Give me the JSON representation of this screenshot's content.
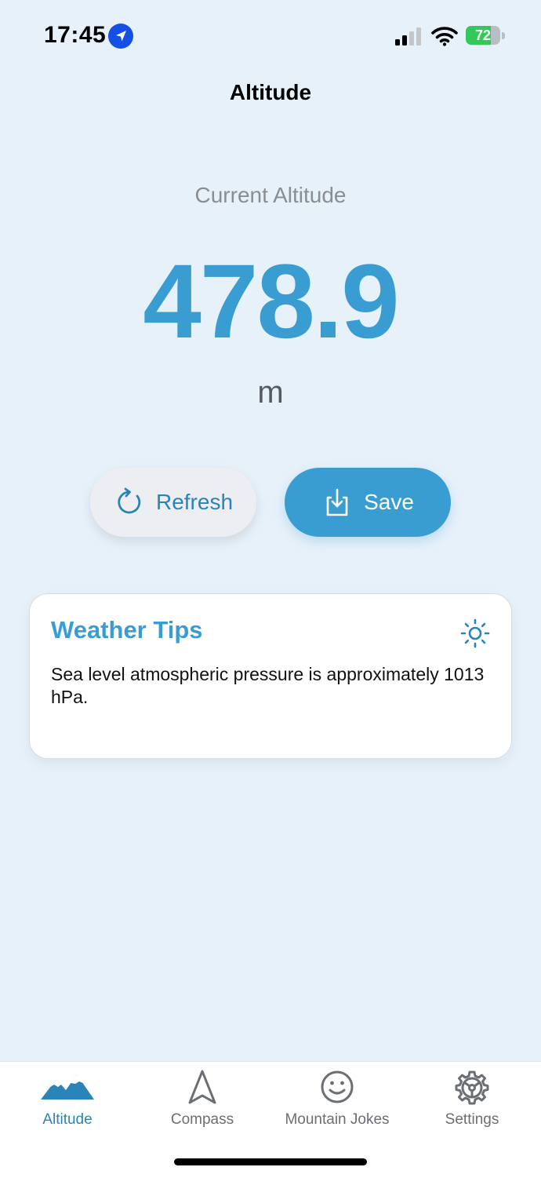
{
  "status_bar": {
    "time": "17:45",
    "battery_level": "72",
    "battery_fraction": 0.72
  },
  "nav": {
    "title": "Altitude"
  },
  "altitude": {
    "label": "Current Altitude",
    "value": "478.9",
    "unit": "m"
  },
  "actions": {
    "refresh_label": "Refresh",
    "save_label": "Save"
  },
  "tips": {
    "title": "Weather Tips",
    "text": "Sea level atmospheric pressure is approximately 1013 hPa.",
    "icon": "sun-icon"
  },
  "tab_bar": {
    "items": [
      {
        "label": "Altitude",
        "icon": "mountains-icon",
        "active": true
      },
      {
        "label": "Compass",
        "icon": "compass-arrow-icon",
        "active": false
      },
      {
        "label": "Mountain Jokes",
        "icon": "smiley-icon",
        "active": false
      },
      {
        "label": "Settings",
        "icon": "gear-icon",
        "active": false
      }
    ]
  },
  "colors": {
    "accent": "#3a9dd2",
    "background": "#e7f1fa",
    "battery_green": "#34c759"
  }
}
